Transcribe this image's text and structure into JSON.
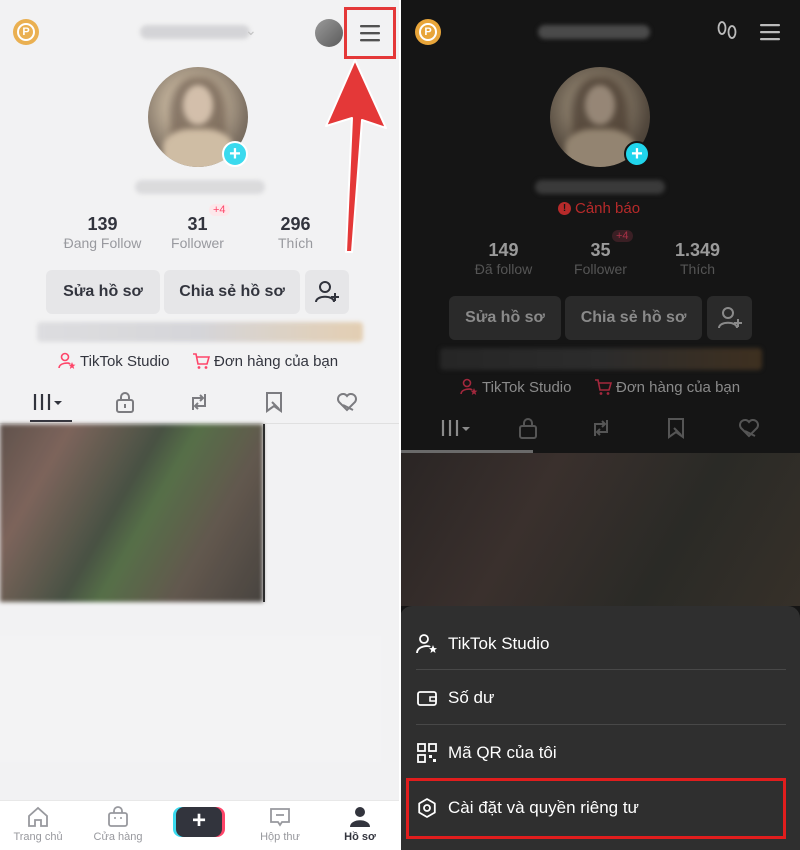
{
  "left": {
    "coin_letter": "P",
    "username_blurred": "Như Phương",
    "handle_blurred": "@nhuphuong238",
    "stats": [
      {
        "value": "139",
        "label": "Đang Follow",
        "badge": ""
      },
      {
        "value": "31",
        "label": "Follower",
        "badge": "+4"
      },
      {
        "value": "296",
        "label": "Thích",
        "badge": ""
      }
    ],
    "buttons": {
      "edit": "Sửa hồ sơ",
      "share": "Chia sẻ hồ sơ"
    },
    "studio_label": "TikTok Studio",
    "orders_label": "Đơn hàng của bạn",
    "nav": [
      {
        "label": "Trang chủ",
        "icon": "home-icon"
      },
      {
        "label": "Cửa hàng",
        "icon": "shop-icon"
      },
      {
        "label": "",
        "icon": "create-plus-icon"
      },
      {
        "label": "Hộp thư",
        "icon": "inbox-icon"
      },
      {
        "label": "Hồ sơ",
        "icon": "profile-icon"
      }
    ],
    "create_symbol": "+"
  },
  "right": {
    "coin_letter": "P",
    "username_blurred": "Như Phương",
    "handle_blurred": "@nhuphuong238",
    "warning": "Cảnh báo",
    "stats": [
      {
        "value": "149",
        "label": "Đã follow",
        "badge": ""
      },
      {
        "value": "35",
        "label": "Follower",
        "badge": "+4"
      },
      {
        "value": "1.349",
        "label": "Thích",
        "badge": ""
      }
    ],
    "buttons": {
      "edit": "Sửa hồ sơ",
      "share": "Chia sẻ hồ sơ"
    },
    "studio_label": "TikTok Studio",
    "orders_label": "Đơn hàng của bạn",
    "menu": [
      {
        "label": "TikTok Studio",
        "icon": "person-star-icon"
      },
      {
        "label": "Số dư",
        "icon": "wallet-icon"
      },
      {
        "label": "Mã QR của tôi",
        "icon": "qr-code-icon"
      },
      {
        "label": "Cài đặt và quyền riêng tư",
        "icon": "settings-icon"
      }
    ]
  },
  "colors": {
    "accent_red": "#fe2c55",
    "highlight": "#e11d1d",
    "teal": "#20d5ec",
    "coin": "#e8a53a"
  }
}
